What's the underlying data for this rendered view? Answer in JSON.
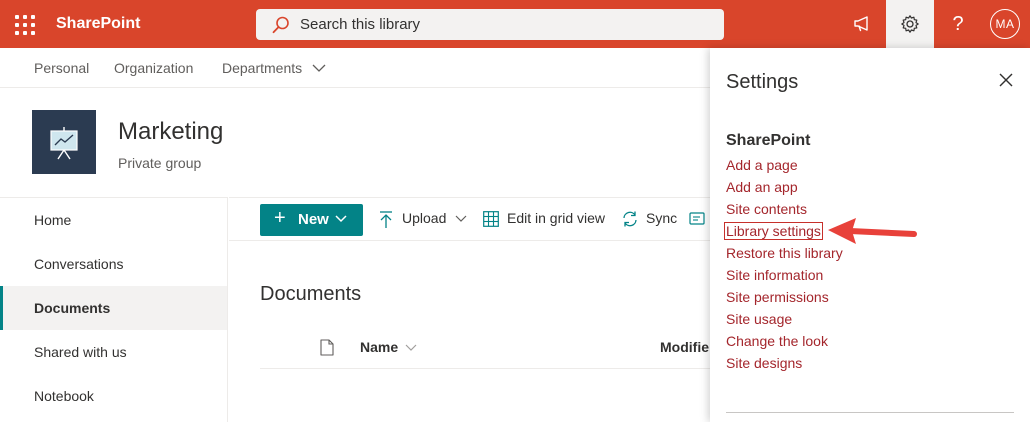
{
  "suitebar": {
    "brand": "SharePoint",
    "search_placeholder": "Search this library",
    "avatar_initials": "MA",
    "help_glyph": "?",
    "icons": [
      "waffle-icon",
      "search-icon",
      "megaphone-icon",
      "gear-icon",
      "help-icon"
    ]
  },
  "hubnav": {
    "items": [
      "Personal",
      "Organization",
      "Departments"
    ]
  },
  "site": {
    "title": "Marketing",
    "subtitle": "Private group"
  },
  "leftnav": {
    "items": [
      "Home",
      "Conversations",
      "Documents",
      "Shared with us",
      "Notebook"
    ],
    "selected": "Documents"
  },
  "commandbar": {
    "new_label": "New",
    "upload_label": "Upload",
    "grid_label": "Edit in grid view",
    "sync_label": "Sync"
  },
  "library": {
    "title": "Documents",
    "columns": [
      "Name",
      "Modifie"
    ]
  },
  "settings_panel": {
    "title": "Settings",
    "section": "SharePoint",
    "links": [
      "Add a page",
      "Add an app",
      "Site contents",
      "Library settings",
      "Restore this library",
      "Site information",
      "Site permissions",
      "Site usage",
      "Change the look",
      "Site designs"
    ],
    "highlighted": "Library settings"
  },
  "colors": {
    "suitebar": "#d9452b",
    "accent": "#038387",
    "link": "#a4262c",
    "annotation": "#e8413a"
  }
}
